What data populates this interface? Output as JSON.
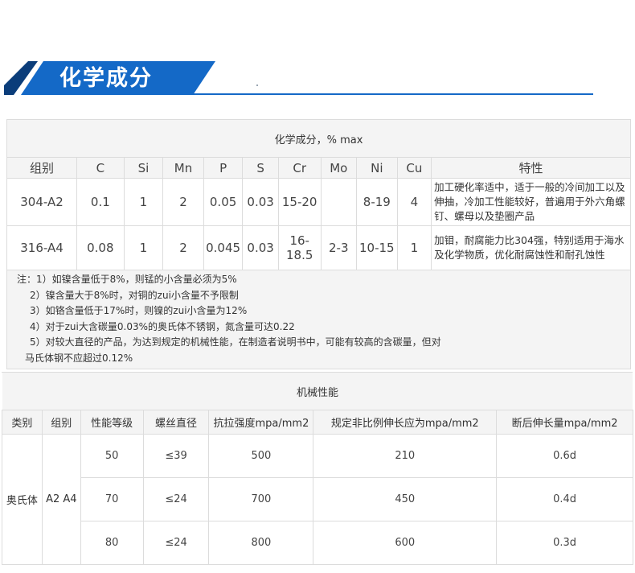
{
  "header": {
    "title": "化学成分"
  },
  "chemical": {
    "caption": "化学成分，% max",
    "headers": [
      "组别",
      "C",
      "Si",
      "Mn",
      "P",
      "S",
      "Cr",
      "Mo",
      "Ni",
      "Cu",
      "特性"
    ],
    "rows": [
      {
        "cells": [
          "304-A2",
          "0.1",
          "1",
          "2",
          "0.05",
          "0.03",
          "15-20",
          "",
          "8-19",
          "4"
        ],
        "property": "加工硬化率适中，适于一般的冷间加工以及伸抽，冷加工性能较好，普遍用于外六角螺钉、螺母以及垫圈产品"
      },
      {
        "cells": [
          "316-A4",
          "0.08",
          "1",
          "2",
          "0.045",
          "0.03",
          "16-18.5",
          "2-3",
          "10-15",
          "1"
        ],
        "property": "加钼，耐腐能力比304强，特别适用于海水及化学物质，优化耐腐蚀性和耐孔蚀性"
      }
    ],
    "notes": [
      "注：1）如镍含量低于8%，则锰的小含量必须为5%",
      "2）镍含量大于8%时，对铜的zui小含量不予限制",
      "3）如铬含量低于17%时，则镍的zui小含量为12%",
      "4）对于zui大含碳量0.03%的奥氏体不锈钢，氮含量可达0.22",
      "5）对较大直径的产品，为达到规定的机械性能，在制造者说明书中，可能有较高的含碳量，但对",
      "马氏体钢不应超过0.12%"
    ]
  },
  "mechanical": {
    "caption": "机械性能",
    "headers": [
      "类别",
      "组别",
      "性能等级",
      "螺丝直径",
      "抗拉强度mpa/mm2",
      "规定非比例伸长应为mpa/mm2",
      "断后伸长量mpa/mm2"
    ],
    "category": "奥氏体",
    "group": "A2 A4",
    "rows": [
      [
        "50",
        "≤39",
        "500",
        "210",
        "0.6d"
      ],
      [
        "70",
        "≤24",
        "700",
        "450",
        "0.4d"
      ],
      [
        "80",
        "≤24",
        "800",
        "600",
        "0.3d"
      ]
    ]
  }
}
